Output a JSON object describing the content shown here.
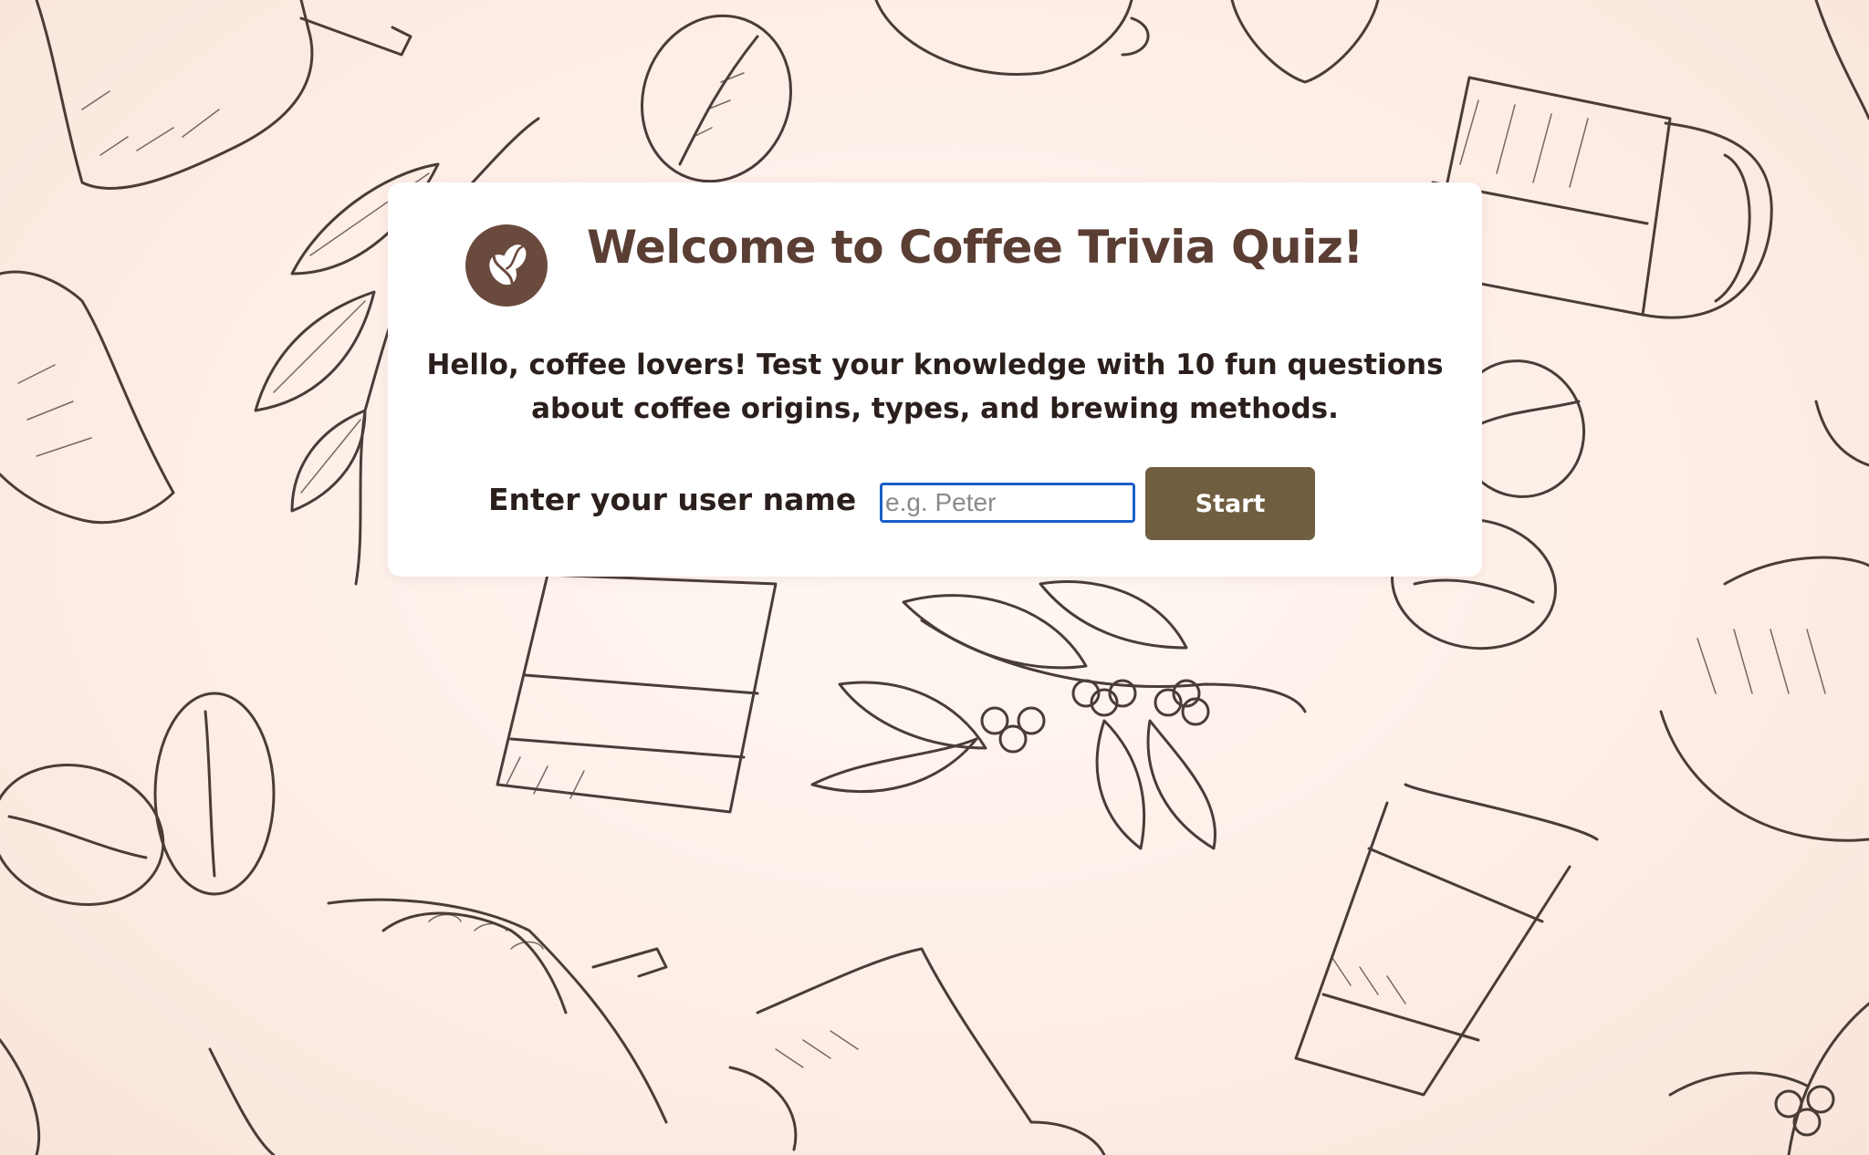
{
  "page": {
    "title": "Welcome to Coffee Trivia Quiz!",
    "intro": "Hello, coffee lovers! Test your knowledge with 10 fun questions about coffee origins, types, and brewing methods.",
    "logo_icon": "coffee-beans-icon"
  },
  "form": {
    "label": "Enter your user name",
    "placeholder": "e.g. Peter",
    "value": "",
    "start_label": "Start"
  },
  "background": {
    "illustrations": [
      "coffee-sack-icon",
      "coffee-bean-icon",
      "coffee-cup-icon",
      "coffee-branch-icon",
      "coffee-pot-icon",
      "pour-over-icon"
    ]
  },
  "colors": {
    "title": "#5a3d33",
    "logo_bg": "#6b4a3e",
    "button_bg": "#705e40",
    "input_focus_border": "#1a5fc8",
    "background": "#fdeee6"
  }
}
